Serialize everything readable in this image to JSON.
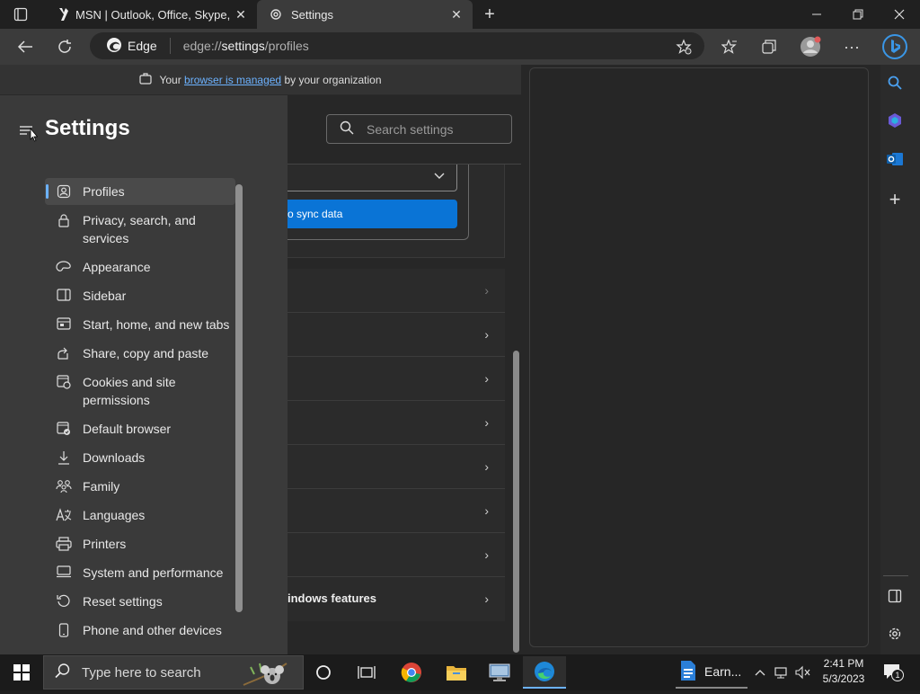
{
  "tabs": [
    {
      "title": "MSN | Outlook, Office, Skype, Bing",
      "active": false
    },
    {
      "title": "Settings",
      "active": true
    }
  ],
  "address": {
    "badge": "Edge",
    "url_prefix": "edge://",
    "url_bold": "settings",
    "url_suffix": "/profiles"
  },
  "managed_bar": {
    "text_before": "Your",
    "link": "browser is managed",
    "text_after": "by your organization"
  },
  "settings": {
    "title": "Settings",
    "search_placeholder": "Search settings",
    "sync_button": "o sync data",
    "rows": [
      "",
      "",
      "",
      "",
      "",
      "",
      "",
      "indows features"
    ],
    "nav": [
      {
        "label": "Profiles",
        "icon": "profile-icon",
        "selected": true
      },
      {
        "label": "Privacy, search, and services",
        "icon": "lock-icon"
      },
      {
        "label": "Appearance",
        "icon": "appearance-icon"
      },
      {
        "label": "Sidebar",
        "icon": "sidebar-icon"
      },
      {
        "label": "Start, home, and new tabs",
        "icon": "home-tabs-icon"
      },
      {
        "label": "Share, copy and paste",
        "icon": "share-icon"
      },
      {
        "label": "Cookies and site permissions",
        "icon": "cookies-icon"
      },
      {
        "label": "Default browser",
        "icon": "default-browser-icon"
      },
      {
        "label": "Downloads",
        "icon": "download-icon"
      },
      {
        "label": "Family",
        "icon": "family-icon"
      },
      {
        "label": "Languages",
        "icon": "languages-icon"
      },
      {
        "label": "Printers",
        "icon": "printer-icon"
      },
      {
        "label": "System and performance",
        "icon": "system-icon"
      },
      {
        "label": "Reset settings",
        "icon": "reset-icon"
      },
      {
        "label": "Phone and other devices",
        "icon": "phone-icon"
      }
    ]
  },
  "taskbar": {
    "search_placeholder": "Type here to search",
    "earn_label": "Earn...",
    "time": "2:41 PM",
    "date": "5/3/2023",
    "notification_count": "1"
  },
  "colors": {
    "accent": "#6cb2ff",
    "sync_button": "#0a74d6"
  }
}
